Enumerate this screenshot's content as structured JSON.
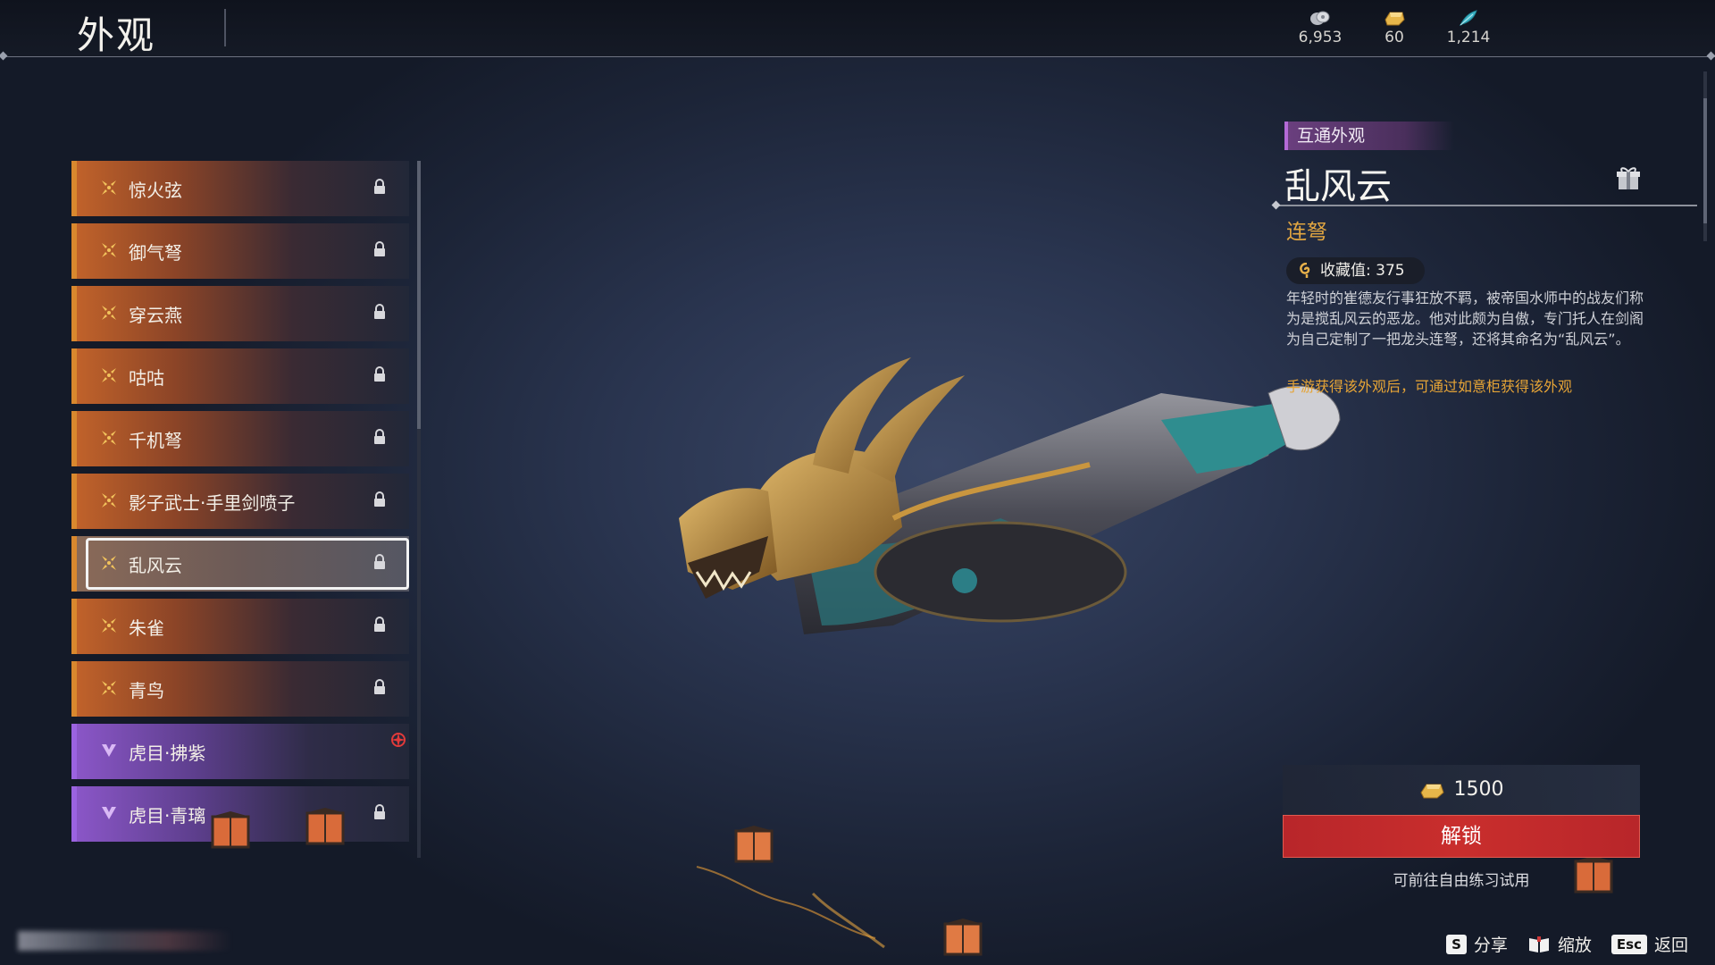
{
  "header": {
    "title": "外观",
    "currencies": [
      {
        "icon": "coins-icon",
        "value": "6,953"
      },
      {
        "icon": "gold-ingot-icon",
        "value": "60"
      },
      {
        "icon": "feather-icon",
        "value": "1,214"
      }
    ]
  },
  "list": {
    "items": [
      {
        "label": "惊火弦",
        "rarity": "gold",
        "locked": true
      },
      {
        "label": "御气弩",
        "rarity": "gold",
        "locked": true
      },
      {
        "label": "穿云燕",
        "rarity": "gold",
        "locked": true
      },
      {
        "label": "咕咕",
        "rarity": "gold",
        "locked": true
      },
      {
        "label": "千机弩",
        "rarity": "gold",
        "locked": true
      },
      {
        "label": "影子武士·手里剑喷子",
        "rarity": "gold",
        "locked": true
      },
      {
        "label": "乱风云",
        "rarity": "gold",
        "locked": true,
        "selected": true
      },
      {
        "label": "朱雀",
        "rarity": "gold",
        "locked": true
      },
      {
        "label": "青鸟",
        "rarity": "gold",
        "locked": true
      },
      {
        "label": "虎目·拂紫",
        "rarity": "purple",
        "locked": false,
        "new": true
      },
      {
        "label": "虎目·青璃",
        "rarity": "purple",
        "locked": true
      }
    ]
  },
  "detail": {
    "tag": "互通外观",
    "name": "乱风云",
    "type": "连弩",
    "collect_label": "收藏值: 375",
    "description": "年轻时的崔德友行事狂放不羁，被帝国水师中的战友们称为是搅乱风云的恶龙。他对此颇为自傲，专门托人在剑阁为自己定制了一把龙头连弩，还将其命名为“乱风云”。",
    "note": "手游获得该外观后，可通过如意柜获得该外观",
    "price": "1500",
    "unlock_label": "解锁",
    "trial_text": "可前往自由练习试用"
  },
  "footer": {
    "hints": [
      {
        "key": "S",
        "label": "分享"
      },
      {
        "key_icon": "book-icon",
        "label": "缩放"
      },
      {
        "key": "Esc",
        "label": "返回"
      }
    ]
  },
  "colors": {
    "gold_rarity": "#d9882e",
    "purple_rarity": "#9b63e0",
    "accent_orange": "#e2a641",
    "unlock_red": "#c92e2d"
  }
}
